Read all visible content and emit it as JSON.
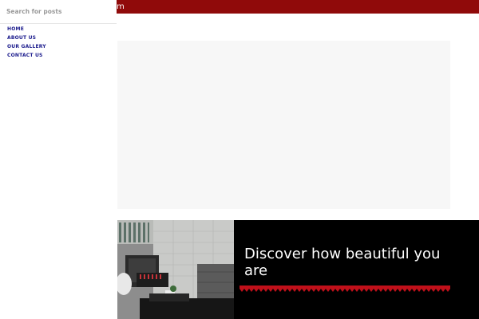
{
  "topbar": {
    "text": "m",
    "color": "#900a0a"
  },
  "drawer": {
    "search": {
      "placeholder": "Search for posts",
      "value": ""
    },
    "nav": [
      {
        "label": "HOME"
      },
      {
        "label": "ABOUT US"
      },
      {
        "label": "OUR GALLERY"
      },
      {
        "label": "CONTACT US"
      }
    ]
  },
  "hero": {
    "heading": "Discover how beautiful you are",
    "accent": "#c0101a",
    "photo": "salon-interior-photo"
  }
}
